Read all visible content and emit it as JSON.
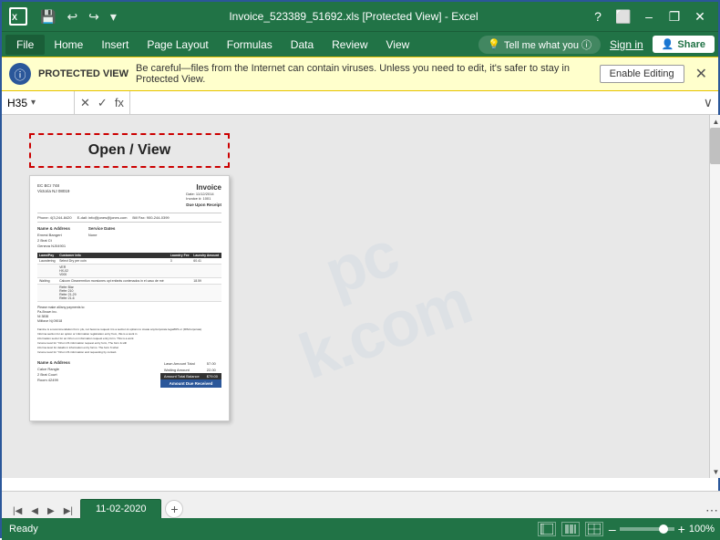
{
  "titleBar": {
    "title": "Invoice_523389_51692.xls [Protected View] - Excel",
    "undoTooltip": "Undo",
    "redoTooltip": "Redo",
    "customizeTooltip": "Customize Quick Access Toolbar",
    "minimizeLabel": "–",
    "maximizeLabel": "□",
    "closeLabel": "✕",
    "restoreLabel": "❐"
  },
  "menuBar": {
    "fileLabel": "File",
    "items": [
      "Home",
      "Insert",
      "Page Layout",
      "Formulas",
      "Data",
      "Review",
      "View"
    ],
    "searchPlaceholder": "Tell me what you want",
    "searchLabel": "Tell me what you ⓘ",
    "signinLabel": "Sign in",
    "shareLabel": "Share",
    "shareIcon": "👤"
  },
  "protectedView": {
    "shieldIcon": "ⓘ",
    "label": "PROTECTED VIEW",
    "message": "Be careful—files from the Internet can contain viruses. Unless you need to edit, it's safer to stay in Protected View.",
    "enableButton": "Enable Editing",
    "closeIcon": "✕"
  },
  "formulaBar": {
    "cellRef": "H35",
    "dropdownIcon": "▾",
    "cancelIcon": "✕",
    "confirmIcon": "✓",
    "functionIcon": "fx",
    "formula": "",
    "expandIcon": "∨"
  },
  "invoice": {
    "openViewLabel": "Open / View",
    "companyLine1": "EC BCr 748",
    "companyLine2": "Victoria NJ 08019",
    "invoiceTitle": "Invoice",
    "dateLabel": "Date:",
    "dateValue": "11/12/2014",
    "invoiceNoLabel": "Invoice #:",
    "invoiceNoValue": "1001",
    "phone": "Phone: 4(3,244-8420",
    "email": "E-dail: info@jones@jones.com",
    "billFax": "Bill Fax: 900-244-0399",
    "dueLine": "Due Upon Receipt",
    "billToLabel": "Name & Address",
    "serviceLabel": "Service Dates",
    "columns": [
      "Lawn/Pay",
      "Customer Info",
      "Laundry Fee",
      "Laundry Amount"
    ],
    "amountDueLabel": "Amount Due:",
    "totalLabel": "Amount Total Balance",
    "totalValue": "$79.00",
    "amountDueValue": "Amount Due Received"
  },
  "sheetTab": {
    "name": "11-02-2020",
    "addLabel": "+"
  },
  "statusBar": {
    "readyLabel": "Ready",
    "zoomPercent": "100%",
    "zoomMinusLabel": "–",
    "zoomPlusLabel": "+"
  },
  "watermark": "pc\nk.com"
}
